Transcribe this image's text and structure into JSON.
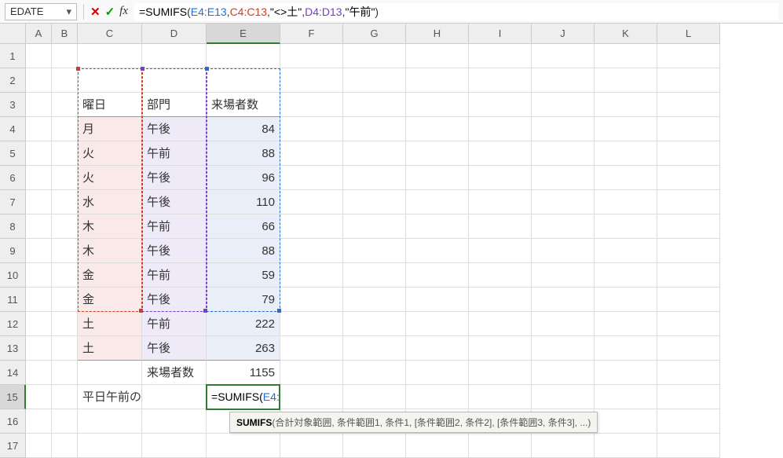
{
  "namebox": "EDATE",
  "formula": {
    "full": "=SUMIFS(E4:E13,C4:C13,\"<>土\",D4:D13,\"午前\")",
    "fn": "SUMIFS",
    "r1": "E4:E13",
    "r2": "C4:C13",
    "t1": "\"<>土\"",
    "r3": "D4:D13",
    "t2": "\"午前\""
  },
  "columns": [
    "A",
    "B",
    "C",
    "D",
    "E",
    "F",
    "G",
    "H",
    "I",
    "J",
    "K",
    "L"
  ],
  "rownums": [
    "1",
    "2",
    "3",
    "4",
    "5",
    "6",
    "7",
    "8",
    "9",
    "10",
    "11",
    "12",
    "13",
    "14",
    "15",
    "16",
    "17"
  ],
  "headers": {
    "c": "曜日",
    "d": "部門",
    "e": "来場者数"
  },
  "rows": [
    {
      "c": "月",
      "d": "午後",
      "e": "84"
    },
    {
      "c": "火",
      "d": "午前",
      "e": "88"
    },
    {
      "c": "火",
      "d": "午後",
      "e": "96"
    },
    {
      "c": "水",
      "d": "午後",
      "e": "110"
    },
    {
      "c": "木",
      "d": "午前",
      "e": "66"
    },
    {
      "c": "木",
      "d": "午後",
      "e": "88"
    },
    {
      "c": "金",
      "d": "午前",
      "e": "59"
    },
    {
      "c": "金",
      "d": "午後",
      "e": "79"
    },
    {
      "c": "土",
      "d": "午前",
      "e": "222"
    },
    {
      "c": "土",
      "d": "午後",
      "e": "263"
    }
  ],
  "row14": {
    "label": "来場者数",
    "total": "1155"
  },
  "row15": {
    "label": "平日午前の来場者数"
  },
  "tooltip": {
    "fn": "SUMIFS",
    "body": "(合計対象範囲, 条件範囲1, 条件1, [条件範囲2, 条件2], [条件範囲3, 条件3], ...)"
  },
  "chart_data": {
    "type": "table",
    "columns": [
      "曜日",
      "部門",
      "来場者数"
    ],
    "rows": [
      [
        "月",
        "午後",
        84
      ],
      [
        "火",
        "午前",
        88
      ],
      [
        "火",
        "午後",
        96
      ],
      [
        "水",
        "午後",
        110
      ],
      [
        "木",
        "午前",
        66
      ],
      [
        "木",
        "午後",
        88
      ],
      [
        "金",
        "午前",
        59
      ],
      [
        "金",
        "午後",
        79
      ],
      [
        "土",
        "午前",
        222
      ],
      [
        "土",
        "午後",
        263
      ]
    ],
    "totals": {
      "来場者数": 1155
    }
  }
}
